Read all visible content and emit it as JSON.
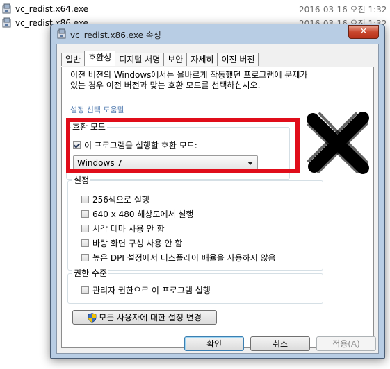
{
  "background_files": [
    {
      "name": "vc_redist.x64.exe",
      "date": "2016-03-16 오전 1:32"
    },
    {
      "name": "vc_redist.x86.exe",
      "date": "2016-03-16 오전 1:32"
    }
  ],
  "dialog": {
    "title": "vc_redist.x86.exe 속성",
    "close_symbol": "✕",
    "tabs": [
      {
        "label": "일반"
      },
      {
        "label": "호환성",
        "active": true
      },
      {
        "label": "디지털 서명"
      },
      {
        "label": "보안"
      },
      {
        "label": "자세히"
      },
      {
        "label": "이전 버전"
      }
    ],
    "description_line1": "이전 버전의 Windows에서는 올바르게 작동했던 프로그램에 문제가",
    "description_line2": "있는 경우 이전 버전과 맞는 호환 모드를 선택하십시오.",
    "help_link": "설정 선택 도움말",
    "compat_group": {
      "title": "호환 모드",
      "checkbox_label": "이 프로그램을 실행할 호환 모드:",
      "checked": true,
      "selected_mode": "Windows 7"
    },
    "settings_group": {
      "title": "설정",
      "options": [
        {
          "label": "256색으로 실행",
          "checked": false
        },
        {
          "label": "640 x 480 해상도에서 실행",
          "checked": false
        },
        {
          "label": "시각 테마 사용 안 함",
          "checked": false
        },
        {
          "label": "바탕 화면 구성 사용 안 함",
          "checked": false
        },
        {
          "label": "높은 DPI 설정에서 디스플레이 배율을 사용하지 않음",
          "checked": false
        }
      ]
    },
    "privilege_group": {
      "title": "권한 수준",
      "checkbox_label": "관리자 권한으로 이 프로그램 실행",
      "checked": false
    },
    "all_users_button": "모든 사용자에 대한 설정 변경",
    "buttons": {
      "ok": "확인",
      "cancel": "취소",
      "apply": "적용(A)"
    }
  },
  "annotations": {
    "highlight_color": "#e00d1a",
    "cross_mark_color": "#000000"
  }
}
